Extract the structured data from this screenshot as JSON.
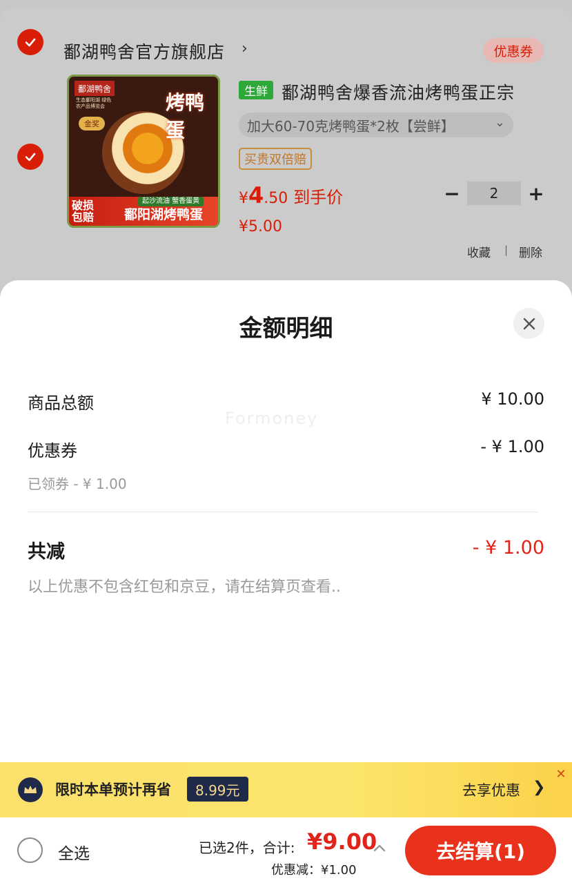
{
  "store": {
    "name": "鄱湖鸭舍官方旗舰店",
    "arrow": "›",
    "coupon_label": "优惠券"
  },
  "product": {
    "image": {
      "brand_logo": "鄱湖鸭舍",
      "small_text": "生态鄱阳湖 绿色农产品博览会",
      "award": "金奖",
      "title": "烤鸭蛋",
      "band_left": "破损包赔",
      "band_sub": "起沙流油 蟹香蛋黄",
      "band_title": "鄱阳湖烤鸭蛋"
    },
    "tag": "生鲜",
    "title": "鄱湖鸭舍爆香流油烤鸭蛋正宗",
    "spec": "加大60-70克烤鸭蛋*2枚【尝鲜】",
    "spec_chevron": "⌄",
    "guarantee_tag": "买贵双倍赔",
    "price_yen": "¥",
    "price_int": "4",
    "price_dec": ".50",
    "price_suffix": "到手价",
    "original_price": "¥5.00",
    "quantity": "2",
    "minus": "−",
    "plus": "+",
    "favorite": "收藏",
    "separator": "|",
    "delete": "删除"
  },
  "sheet": {
    "title": "金额明细",
    "watermark": "Formoney",
    "rows": [
      {
        "label": "商品总额",
        "value": "¥ 10.00"
      },
      {
        "label": "优惠券",
        "value": "- ¥ 1.00",
        "note": "已领券 - ¥ 1.00"
      }
    ],
    "total_label": "共减",
    "total_value": "- ¥ 1.00",
    "disclaimer": "以上优惠不包含红包和京豆，请在结算页查看.."
  },
  "promo": {
    "text": "限时本单预计再省",
    "amount": "8.99元",
    "link": "去享优惠",
    "chevron": "❯",
    "close": "✕"
  },
  "bottom_bar": {
    "select_all": "全选",
    "summary": "已选2件，合计:",
    "total": "¥9.00",
    "discount": "优惠减：¥1.00",
    "checkout": "去结算(1)"
  },
  "colors": {
    "accent_red": "#e2231a",
    "fresh_green": "#2fa83a",
    "promo_yellow": "#fce56c",
    "promo_navy": "#1f2a4a"
  },
  "icons": [
    "check-icon",
    "close-icon",
    "crown-icon",
    "chevron-up-icon",
    "chevron-right-icon"
  ]
}
